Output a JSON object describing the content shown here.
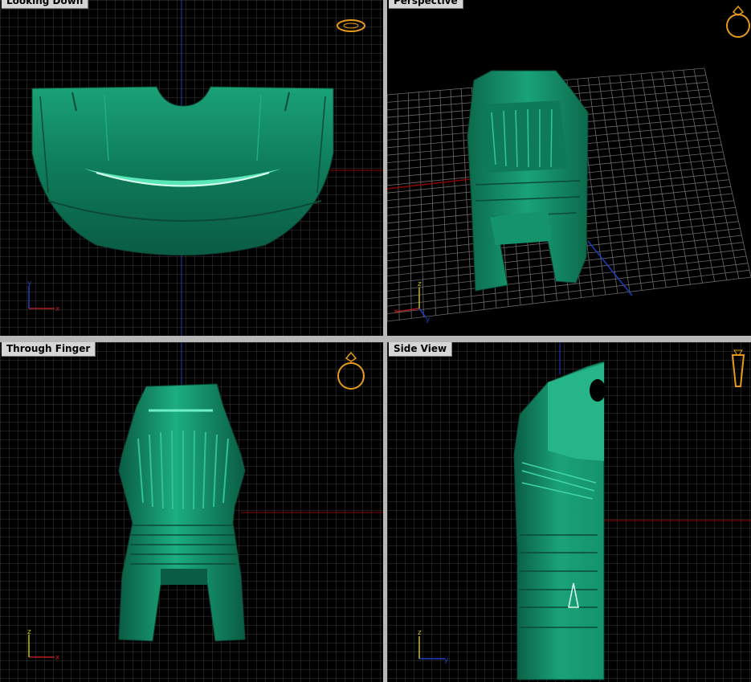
{
  "viewports": {
    "looking_down": {
      "title": "Looking Down"
    },
    "perspective": {
      "title": "Perspective"
    },
    "through_finger": {
      "title": "Through Finger"
    },
    "side_view": {
      "title": "Side View"
    }
  },
  "axes_labels": {
    "x": "x",
    "y": "y",
    "z": "z"
  },
  "colors": {
    "background": "#000000",
    "grid_minor": "#3a3a3a",
    "grid_major": "#5c5c5c",
    "x_axis": "#8b0000",
    "y_axis": "#1a3fbf",
    "model_green": "#0f8a62",
    "model_highlight": "#47d6a8",
    "widget_orange": "#e89a1a"
  },
  "icons": {
    "view_widget": "ring-orientation-icon",
    "axes_triad": "axes-triad-icon"
  }
}
